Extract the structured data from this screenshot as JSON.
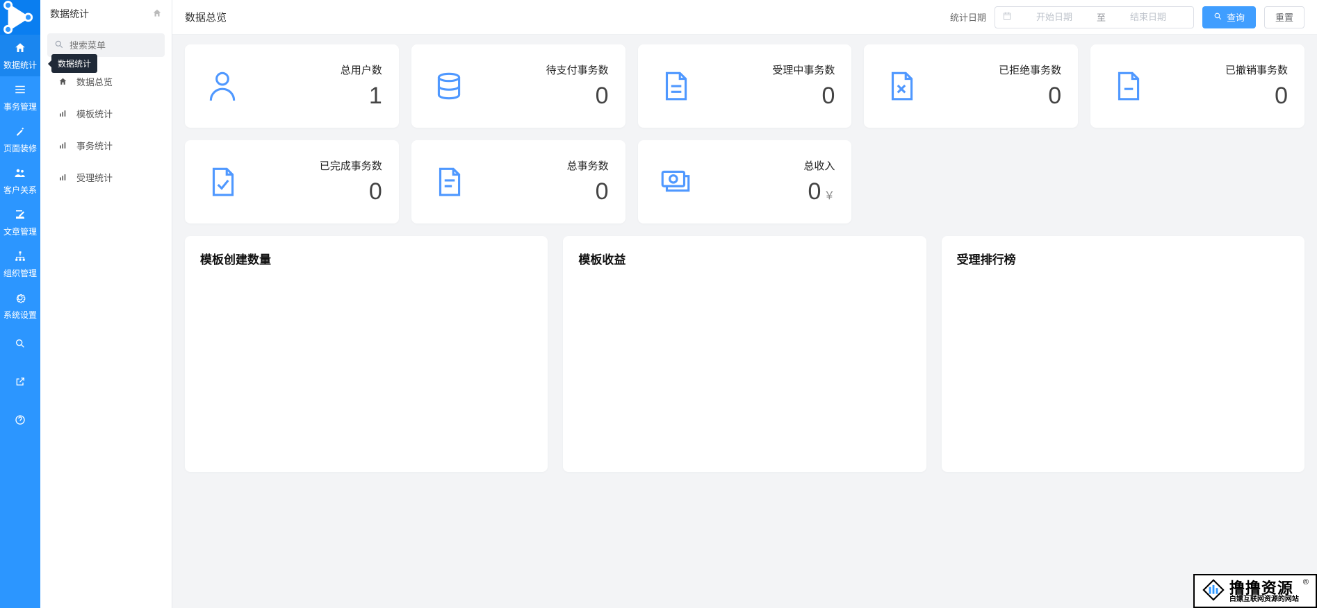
{
  "nav": {
    "items": [
      {
        "label": "数据统计"
      },
      {
        "label": "事务管理"
      },
      {
        "label": "页面装修"
      },
      {
        "label": "客户关系"
      },
      {
        "label": "文章管理"
      },
      {
        "label": "组织管理"
      },
      {
        "label": "系统设置"
      }
    ],
    "tooltip": "数据统计"
  },
  "sidebar": {
    "title": "数据统计",
    "search_placeholder": "搜索菜单",
    "items": [
      {
        "label": "数据总览"
      },
      {
        "label": "模板统计"
      },
      {
        "label": "事务统计"
      },
      {
        "label": "受理统计"
      }
    ]
  },
  "topbar": {
    "title": "数据总览",
    "date_label": "统计日期",
    "start_placeholder": "开始日期",
    "range_sep": "至",
    "end_placeholder": "结束日期",
    "query_label": "查询",
    "reset_label": "重置"
  },
  "stats": [
    {
      "label": "总用户数",
      "value": "1"
    },
    {
      "label": "待支付事务数",
      "value": "0"
    },
    {
      "label": "受理中事务数",
      "value": "0"
    },
    {
      "label": "已拒绝事务数",
      "value": "0"
    },
    {
      "label": "已撤销事务数",
      "value": "0"
    },
    {
      "label": "已完成事务数",
      "value": "0"
    },
    {
      "label": "总事务数",
      "value": "0"
    },
    {
      "label": "总收入",
      "value": "0",
      "unit": "￥"
    }
  ],
  "panels": [
    {
      "title": "模板创建数量"
    },
    {
      "title": "模板收益"
    },
    {
      "title": "受理排行榜"
    }
  ],
  "watermark": {
    "brand": "撸撸资源",
    "sub": "白嫖互联网资源的网站",
    "reg": "®"
  }
}
